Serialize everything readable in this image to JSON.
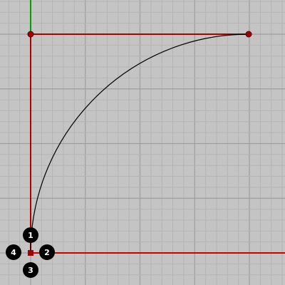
{
  "viewport": {
    "background": "#c4c4c4",
    "grid_color": "#b4b4b4",
    "major_grid_color": "#9e9e9e",
    "x_axis_color": "#c80000",
    "y_axis_color": "#00a000"
  },
  "geometry_colors": {
    "control_polygon": "#b00000",
    "control_point": "#a00000",
    "curve": "#000000"
  },
  "markers": [
    {
      "id": "1",
      "label": "1"
    },
    {
      "id": "2",
      "label": "2"
    },
    {
      "id": "3",
      "label": "3"
    },
    {
      "id": "4",
      "label": "4"
    }
  ],
  "marker_colors": {
    "fill": "#000000",
    "text": "#ffffff"
  }
}
